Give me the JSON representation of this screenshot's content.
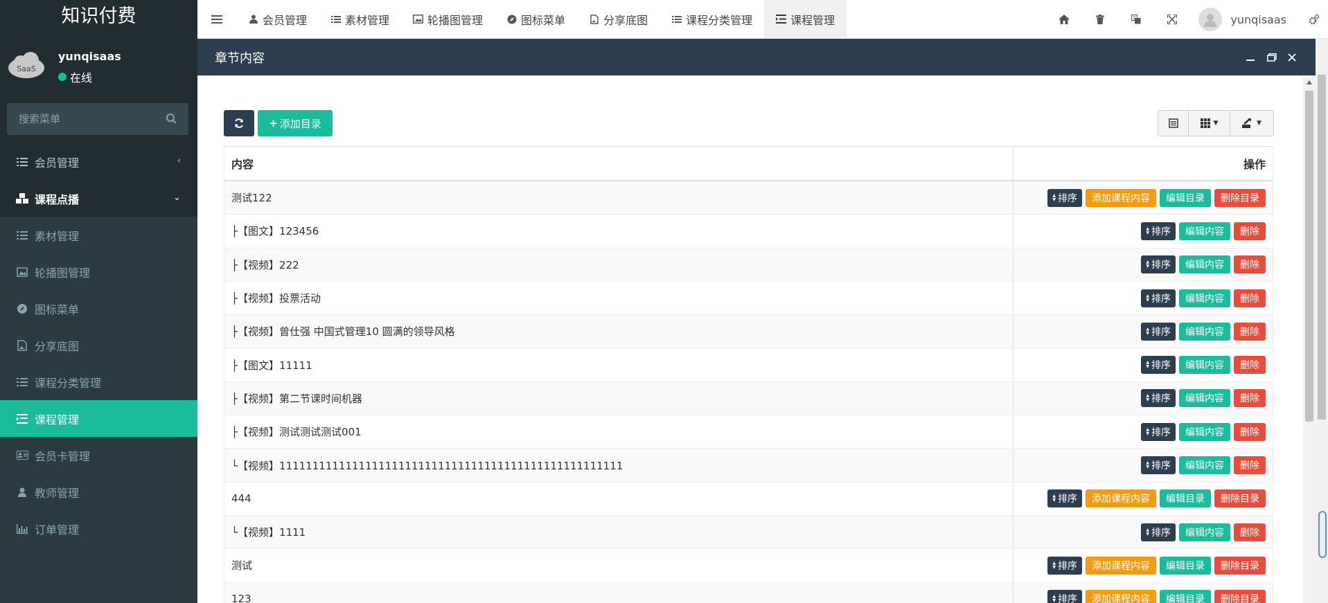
{
  "app": {
    "title": "知识付费"
  },
  "user": {
    "name": "yunqisaas",
    "status": "在线",
    "avatar_text": "SaaS"
  },
  "search": {
    "placeholder": "搜索菜单"
  },
  "sidebar": {
    "items": [
      {
        "label": "会员管理",
        "icon": "list-icon"
      },
      {
        "label": "课程点播",
        "icon": "cubes-icon"
      },
      {
        "label": "素材管理",
        "icon": "list-icon"
      },
      {
        "label": "轮播图管理",
        "icon": "image-icon"
      },
      {
        "label": "图标菜单",
        "icon": "compass-icon"
      },
      {
        "label": "分享底图",
        "icon": "file-image-icon"
      },
      {
        "label": "课程分类管理",
        "icon": "list-icon"
      },
      {
        "label": "课程管理",
        "icon": "list-indent-icon"
      },
      {
        "label": "会员卡管理",
        "icon": "id-card-icon"
      },
      {
        "label": "教师管理",
        "icon": "user-icon"
      },
      {
        "label": "订单管理",
        "icon": "bar-chart-icon"
      }
    ]
  },
  "tabs": [
    {
      "label": "会员管理"
    },
    {
      "label": "素材管理"
    },
    {
      "label": "轮播图管理"
    },
    {
      "label": "图标菜单"
    },
    {
      "label": "分享底图"
    },
    {
      "label": "课程分类管理"
    },
    {
      "label": "课程管理"
    }
  ],
  "topbar": {
    "username": "yunqisaas"
  },
  "panel": {
    "title": "章节内容"
  },
  "toolbar": {
    "add_label": "添加目录"
  },
  "table": {
    "headers": {
      "content": "内容",
      "actions": "操作"
    },
    "labels": {
      "sort": "排序",
      "add_content": "添加课程内容",
      "edit_catalog": "编辑目录",
      "delete_catalog": "删除目录",
      "edit_content": "编辑内容",
      "delete": "删除"
    },
    "rows": [
      {
        "text": "测试122",
        "type": "catalog"
      },
      {
        "text": "├【图文】123456",
        "type": "content"
      },
      {
        "text": "├【视频】222",
        "type": "content"
      },
      {
        "text": "├【视频】投票活动",
        "type": "content"
      },
      {
        "text": "├【视频】曾仕强 中国式管理10 圆满的领导风格",
        "type": "content"
      },
      {
        "text": "├【图文】11111",
        "type": "content"
      },
      {
        "text": "├【视频】第二节课时间机器",
        "type": "content"
      },
      {
        "text": "├【视频】测试测试测试001",
        "type": "content"
      },
      {
        "text": "└【视频】1111111111111111111111111111111111111111111111111111",
        "type": "content"
      },
      {
        "text": "444",
        "type": "catalog"
      },
      {
        "text": "└【视频】1111",
        "type": "content"
      },
      {
        "text": "测试",
        "type": "catalog"
      },
      {
        "text": "123",
        "type": "catalog"
      }
    ]
  },
  "colors": {
    "sidebar_bg": "#222d32",
    "accent": "#1abc9c",
    "panel_head": "#2c3e50",
    "warning": "#f39c12",
    "danger": "#e74c3c"
  }
}
